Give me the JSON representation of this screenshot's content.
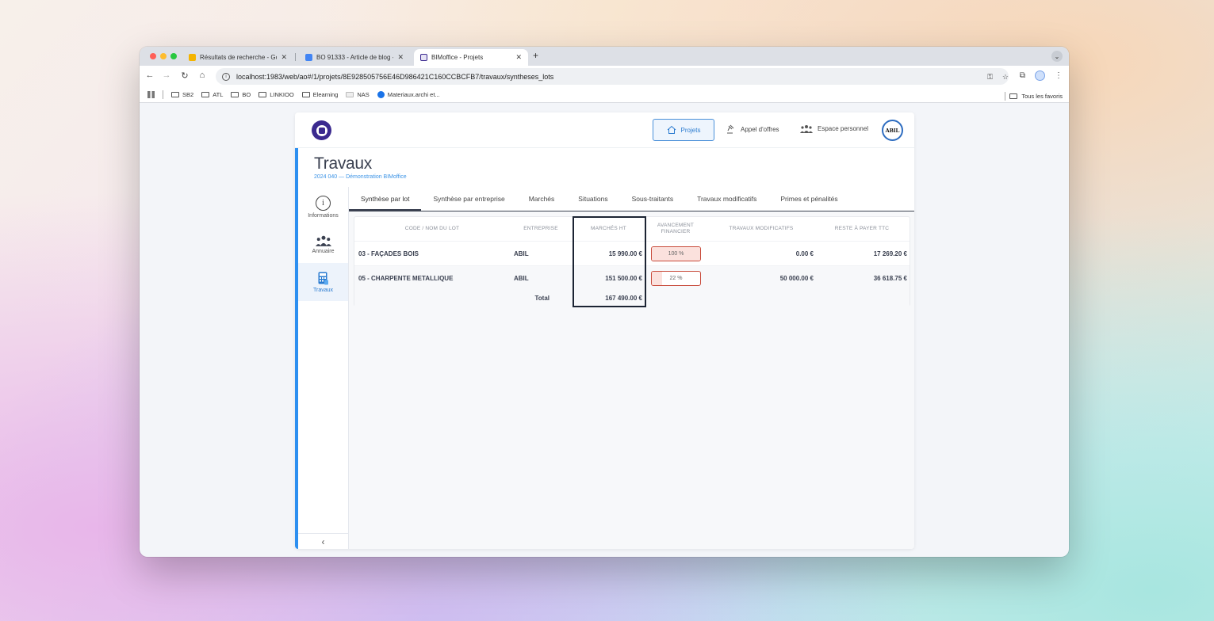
{
  "browser": {
    "tabs": [
      {
        "title": "Résultats de recherche - Goo",
        "favicon_color": "#f4b400"
      },
      {
        "title": "BO 91333 - Article de blog -",
        "favicon_color": "#4285f4"
      },
      {
        "title": "BIMoffice - Projets",
        "favicon_color": "#3b2a8f",
        "active": true
      }
    ],
    "url": "localhost:1983/web/ao#/1/projets/8E928505756E46D986421C160CCBCFB7/travaux/syntheses_lots",
    "bookmarks": [
      "SB2",
      "ATL",
      "BO",
      "LINKIOO",
      "Elearning",
      "NAS",
      "Materiaux.archi et..."
    ],
    "bookmarks_right": "Tous les favoris"
  },
  "header": {
    "nav": {
      "projets": "Projets",
      "appel_offres": "Appel d'offres",
      "espace": "Espace personnel"
    },
    "avatar_text": "ABIL"
  },
  "page": {
    "title": "Travaux",
    "subtitle": "2024 040 — Démonstration BIMoffice"
  },
  "sidebar": {
    "items": [
      {
        "label": "Informations",
        "icon": "info-icon"
      },
      {
        "label": "Annuaire",
        "icon": "people-icon"
      },
      {
        "label": "Travaux",
        "icon": "calculator-icon",
        "active": true
      }
    ]
  },
  "tabs": [
    "Synthèse par lot",
    "Synthèse par entreprise",
    "Marchés",
    "Situations",
    "Sous-traitants",
    "Travaux modificatifs",
    "Primes et pénalités"
  ],
  "table": {
    "headers": {
      "lot": "CODE / NOM DU LOT",
      "entreprise": "ENTREPRISE",
      "marches": "MARCHÉS HT",
      "avancement_1": "AVANCEMENT",
      "avancement_2": "FINANCIER",
      "travaux": "TRAVAUX MODIFICATIFS",
      "reste": "RESTE À PAYER TTC"
    },
    "rows": [
      {
        "lot": "03 - FAÇADES BOIS",
        "entreprise": "ABIL",
        "marches": "15 990.00 €",
        "avancement": "100 %",
        "avancement_value": 1.0,
        "travaux": "0.00 €",
        "reste": "17 269.20 €"
      },
      {
        "lot": "05 - CHARPENTE METALLIQUE",
        "entreprise": "ABIL",
        "marches": "151 500.00 €",
        "avancement": "22 %",
        "avancement_value": 0.22,
        "travaux": "50 000.00 €",
        "reste": "36 618.75 €"
      }
    ],
    "total_label": "Total",
    "total_marches": "167 490.00 €"
  },
  "colors": {
    "accent": "#2d8ff0",
    "brand": "#3b2a8f",
    "progress_border": "#c84a3a"
  }
}
